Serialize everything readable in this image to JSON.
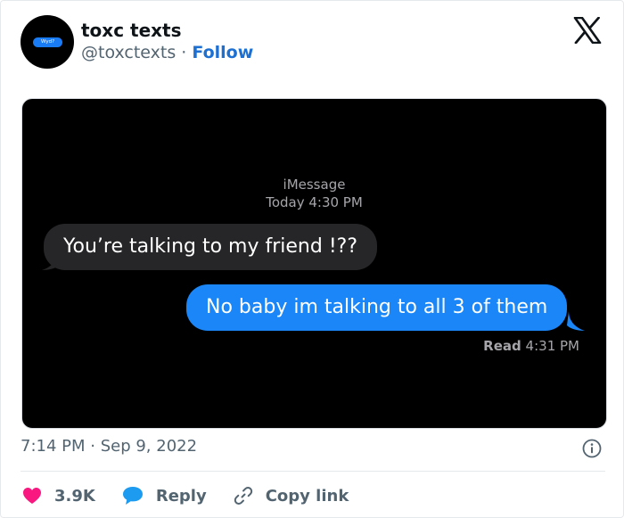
{
  "account": {
    "name": "toxc texts",
    "handle": "@toxctexts",
    "separator": "·",
    "follow_label": "Follow",
    "avatar_text": "Wyd?"
  },
  "screenshot": {
    "service": "iMessage",
    "date_time": "Today 4:30 PM",
    "messages": [
      {
        "direction": "received",
        "text": "You’re talking to my friend !??"
      },
      {
        "direction": "sent",
        "text": "No baby im talking to all 3 of them"
      }
    ],
    "read_label": "Read",
    "read_time": "4:31 PM"
  },
  "post": {
    "timestamp": "7:14 PM · Sep 9, 2022"
  },
  "actions": {
    "likes": "3.9K",
    "reply_label": "Reply",
    "copy_link_label": "Copy link"
  },
  "colors": {
    "like_heart": "#f91880",
    "reply_bubble": "#1d9bf0",
    "follow": "#1d6fd1",
    "sent_bubble": "#1a86f7",
    "received_bubble": "#262628"
  },
  "icons": [
    "x-logo-icon",
    "info-icon",
    "heart-icon",
    "reply-icon",
    "link-icon"
  ]
}
